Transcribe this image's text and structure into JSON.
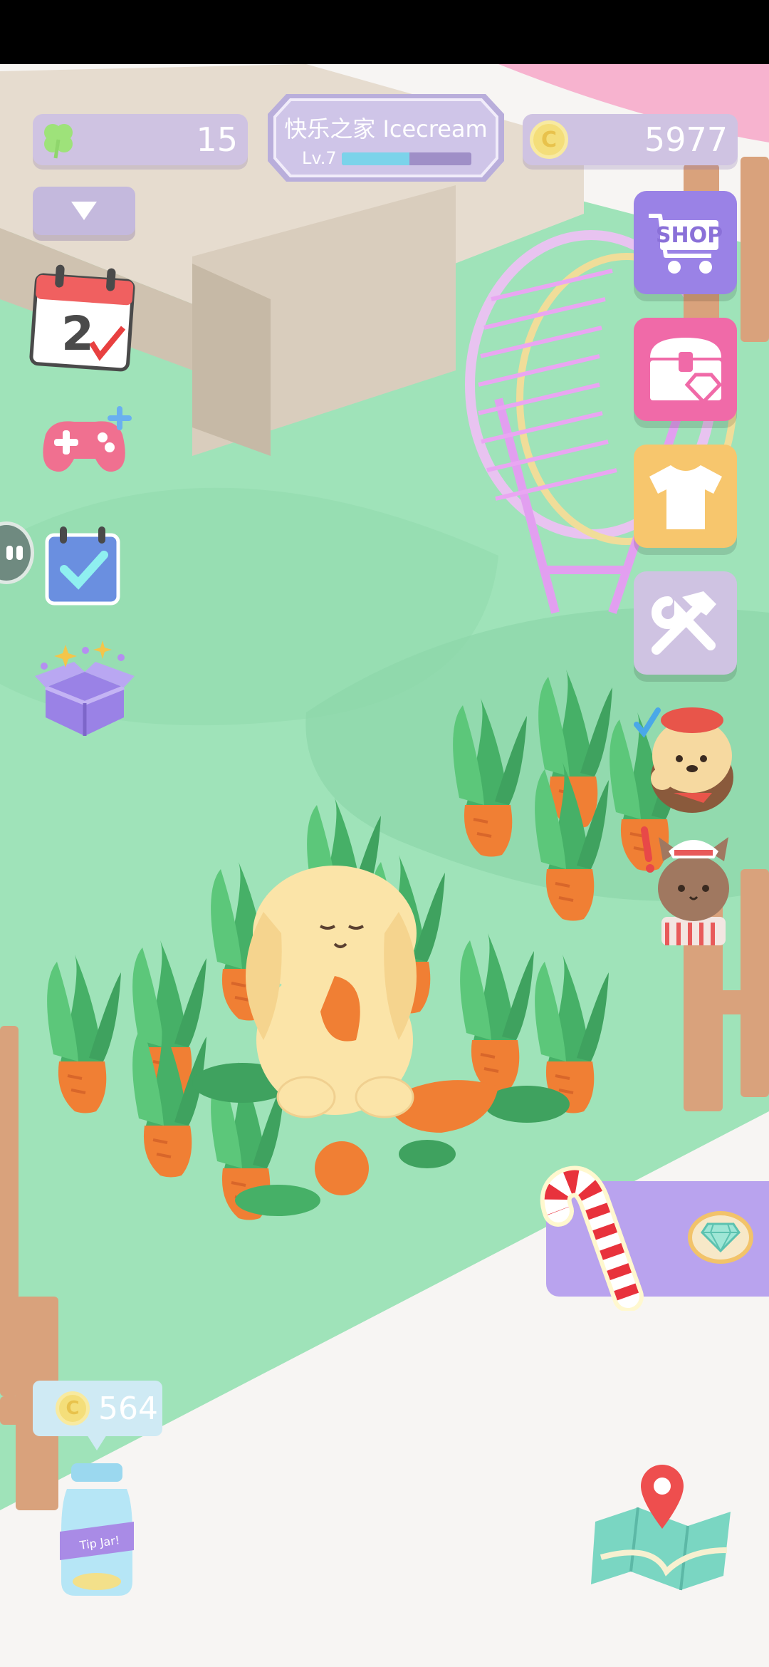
{
  "hud": {
    "clover_count": "15",
    "coin_count": "5977",
    "home_name": "快乐之家 Icecream",
    "level_label": "Lv.7",
    "level_progress": 0.52
  },
  "calendar": {
    "day": "2"
  },
  "shop": {
    "label": "SHOP"
  },
  "tip_jar": {
    "coins": "564",
    "label": "Tip Jar!"
  },
  "icons": {
    "clover": "clover-icon",
    "coin": "coin-icon",
    "dropdown": "chevron-down-icon",
    "calendar": "calendar-checkin-icon",
    "gamepad": "gamepad-plus-icon",
    "tasks": "task-checklist-icon",
    "giftbox": "sparkle-box-icon",
    "shop": "shopping-cart-icon",
    "chest": "treasure-chest-icon",
    "wardrobe": "tshirt-icon",
    "tools": "hammer-wrench-icon",
    "map": "map-pin-icon",
    "diamond": "diamond-icon",
    "candy_cane": "candy-cane-icon"
  },
  "colors": {
    "grass": "#9fe3b9",
    "hud_pill": "#cfc3e2",
    "shop_purple": "#9a82e6",
    "chest_pink": "#f06aa8",
    "wardrobe_yellow": "#f7c66d",
    "tools_lavender": "#cfc3e2",
    "banner_purple": "#b9a3ee"
  }
}
